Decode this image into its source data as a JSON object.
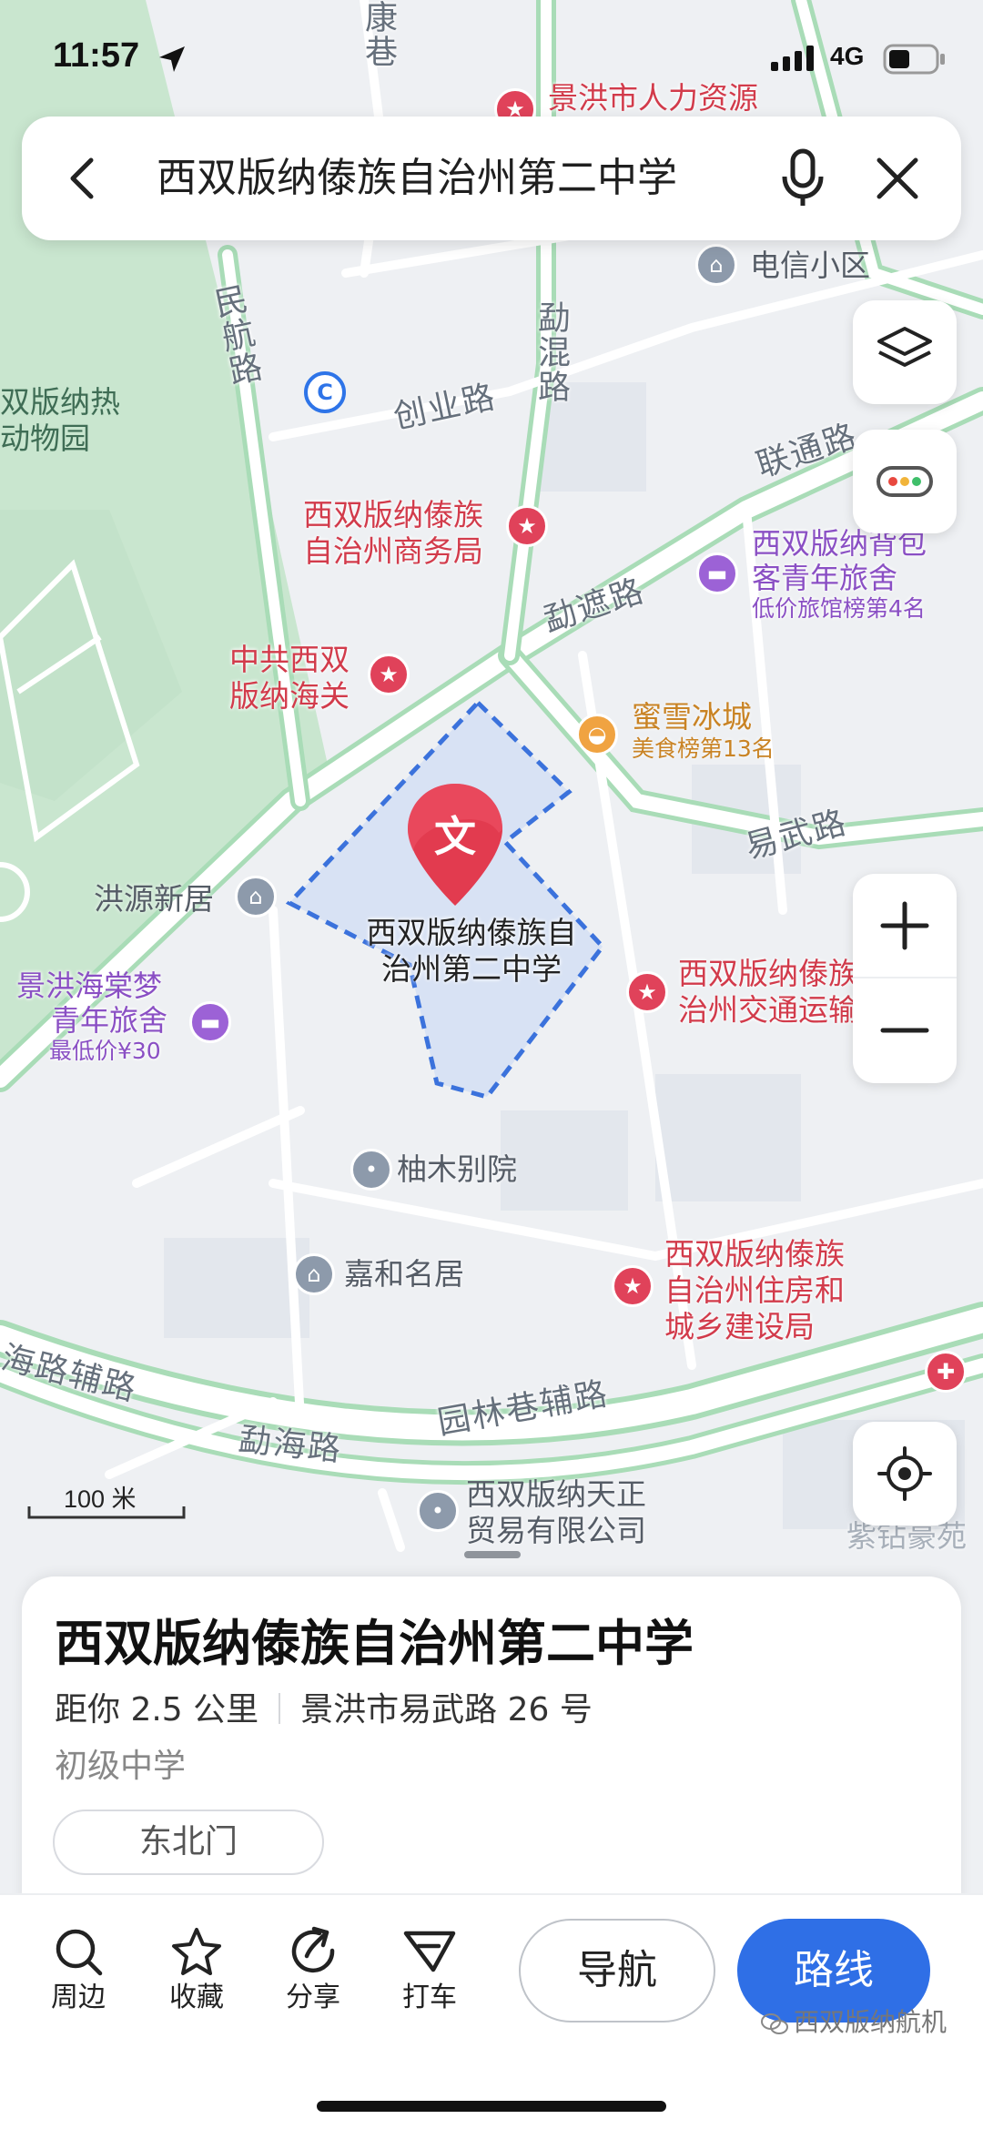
{
  "status_bar": {
    "time": "11:57",
    "network": "4G"
  },
  "search": {
    "query": "西双版纳傣族自治州第二中学"
  },
  "map": {
    "roads": {
      "kang_xiang": "康巷",
      "minhang_lu": "民航路",
      "mengkun_lu": "勐混路",
      "chuangye_lu": "创业路",
      "liantong_lu": "联通路",
      "mengzhe_lu": "勐遮路",
      "yiwu_lu": "易武路",
      "yuanlin_fulu": "园林巷辅路",
      "menghai_lu": "勐海路",
      "hai_fulu": "海路辅路"
    },
    "pois": {
      "renli": "景洪市人力资源",
      "dianxin": "电信小区",
      "rebelt_1": "双版纳热",
      "rebelt_2": "动物园",
      "shangwu_1": "西双版纳傣族",
      "shangwu_2": "自治州商务局",
      "youth_1": "西双版纳背包",
      "youth_2": "客青年旅舍",
      "youth_3": "低价旅馆榜第4名",
      "haiguan_1": "中共西双",
      "haiguan_2": "版纳海关",
      "mixue_1": "蜜雪冰城",
      "mixue_2": "美食榜第13名",
      "hongyuan": "洪源新居",
      "haitang_1": "景洪海棠梦",
      "haitang_2": "青年旅舍",
      "haitang_3": "最低价¥30",
      "jiaotong_1": "西双版纳傣族",
      "jiaotong_2": "治州交通运输",
      "youmu": "柚木别院",
      "jiahe": "嘉和名居",
      "zhufang_1": "西双版纳傣族",
      "zhufang_2": "自治州住房和",
      "zhufang_3": "城乡建设局",
      "tianzheng_1": "西双版纳天正",
      "tianzheng_2": "贸易有限公司",
      "zishi": "紫钻豪苑",
      "yuan_partial": "源",
      "school_1": "西双版纳傣族自",
      "school_2": "治州第二中学",
      "school_marker_char": "文"
    },
    "scale": "100 米"
  },
  "card": {
    "title": "西双版纳傣族自治州第二中学",
    "distance": "距你 2.5 公里",
    "address": "景洪市易武路 26 号",
    "category": "初级中学",
    "entrance": "东北门"
  },
  "bottom_bar": {
    "nearby": "周边",
    "favorite": "收藏",
    "share": "分享",
    "taxi": "打车",
    "navigate": "导航",
    "route": "路线"
  },
  "watermark": "西双版纳航机"
}
